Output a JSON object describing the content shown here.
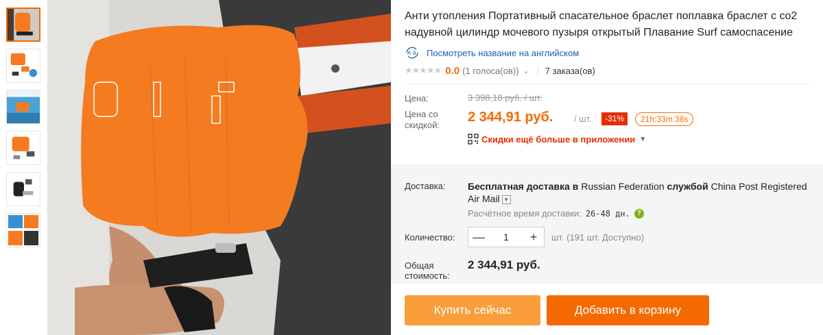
{
  "product": {
    "title": "Анти утопления Портативный спасательное браслет поплавка браслет с co2 надувной цилиндр мочевого пузыря открытый Плавание Surf самоспасение",
    "translate_link": "Посмотреть название на английском",
    "stars": "★★★★★",
    "rating": "0.0",
    "votes": "(1 голоса(ов))",
    "orders": "7 заказа(ов)"
  },
  "price": {
    "label": "Цена:",
    "old": "3 398,18 руб. / шт.",
    "discount_label": "Цена со скидкой:",
    "new": "2 344,91 руб.",
    "per_unit": "/ шт.",
    "discount_badge": "-31%",
    "timer": "21h:33m:38s",
    "app_promo": "Скидки ещё больше в приложении"
  },
  "shipping": {
    "label": "Доставка:",
    "prefix": "Бесплатная доставка в",
    "country": "Russian Federation",
    "by": "службой",
    "carrier": "China Post Registered Air Mail",
    "eta_label": "Расчётное время доставки:",
    "eta_value": "26-48 дн."
  },
  "quantity": {
    "label": "Количество:",
    "value": "1",
    "minus": "—",
    "plus": "+",
    "available": "шт. (191 шт. Доступно)"
  },
  "total": {
    "label": "Общая стоимость:",
    "value": "2 344,91 руб."
  },
  "actions": {
    "buy_now": "Купить сейчас",
    "add_to_cart": "Добавить в корзину"
  },
  "colors": {
    "accent": "#f56a00",
    "buy_now": "#f99e3b",
    "discount": "#e62e04",
    "link": "#1a5fb4"
  }
}
